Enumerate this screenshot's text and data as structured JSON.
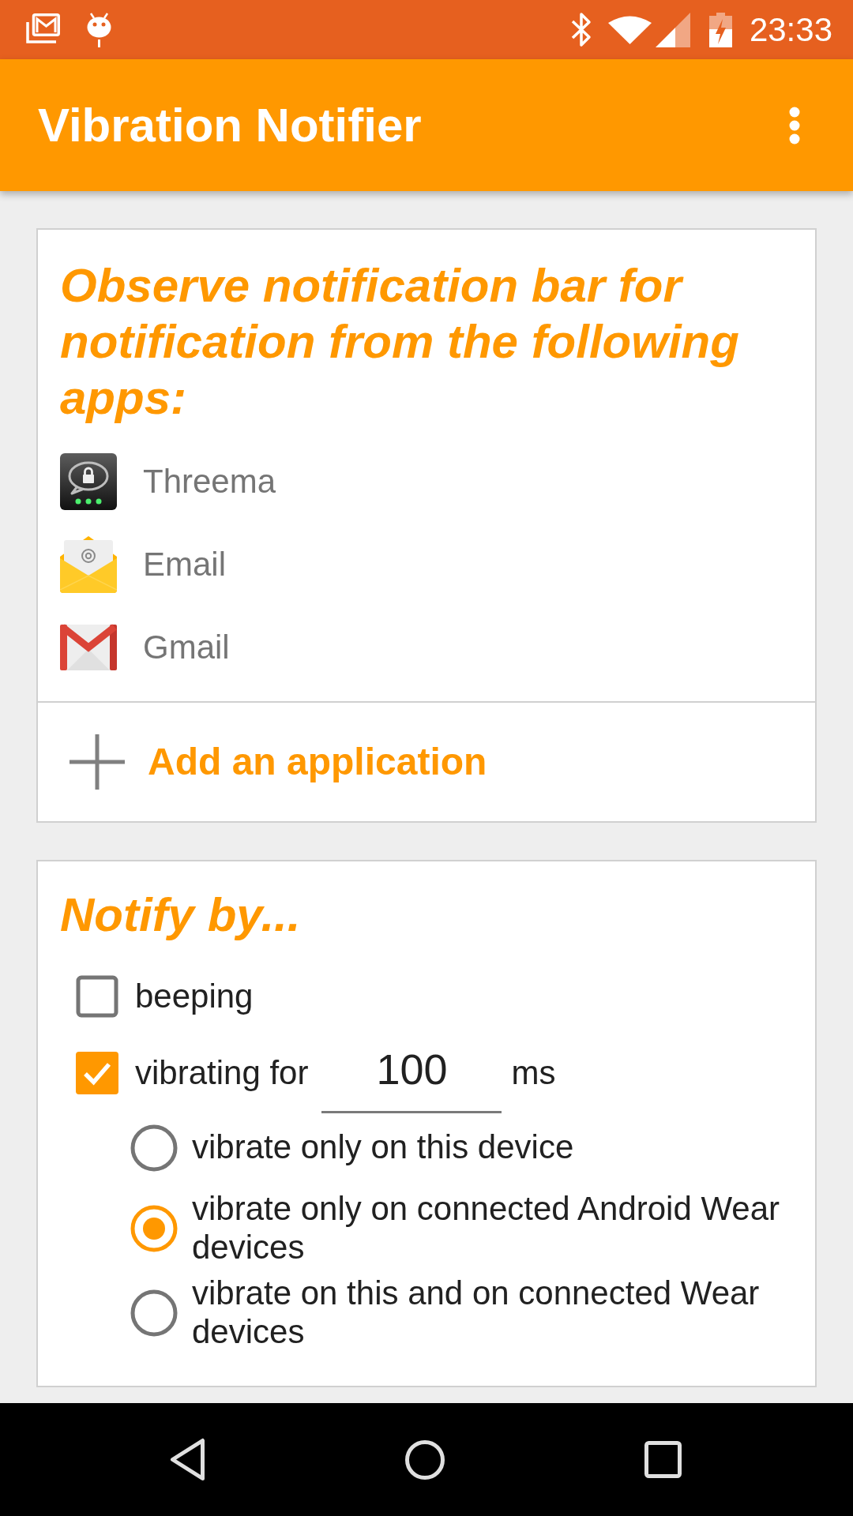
{
  "status_bar": {
    "time": "23:33"
  },
  "app_bar": {
    "title": "Vibration Notifier"
  },
  "apps_card": {
    "heading": "Observe notification bar for notification from the following apps:",
    "apps": [
      {
        "name": "Threema"
      },
      {
        "name": "Email"
      },
      {
        "name": "Gmail"
      }
    ],
    "add_button": {
      "label": "Add an application"
    }
  },
  "notify_card": {
    "heading": "Notify by...",
    "options": [
      {
        "label": "beeping",
        "checked": false
      },
      {
        "label": "vibrating for",
        "checked": true,
        "duration": {
          "value": "100",
          "unit": "ms"
        }
      }
    ],
    "vibrate_targets": [
      {
        "label": "vibrate only on this device",
        "selected": false
      },
      {
        "label": "vibrate only on connected Android Wear devices",
        "selected": true
      },
      {
        "label": "vibrate on this and on connected Wear devices",
        "selected": false
      }
    ]
  }
}
